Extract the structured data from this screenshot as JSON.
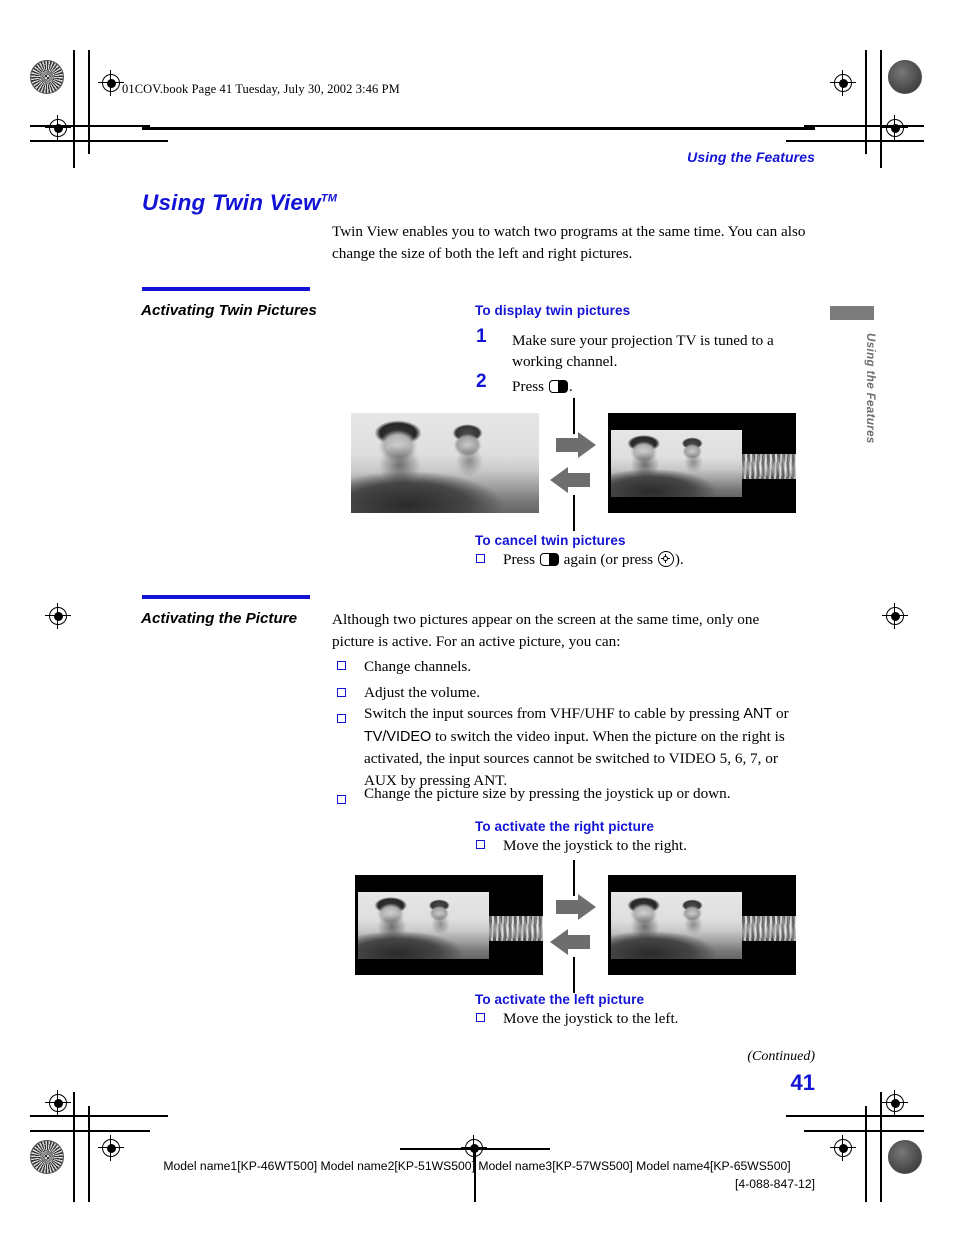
{
  "header": {
    "filestamp": "01COV.book  Page 41  Tuesday, July 30, 2002  3:46 PM",
    "running_head": "Using the Features"
  },
  "side_tab": {
    "label": "Using the Features"
  },
  "title": {
    "main": "Using Twin View",
    "trademark": "TM"
  },
  "intro": "Twin View enables you to watch two programs at the same time. You can also change the size of both the left and right pictures.",
  "sections": [
    {
      "heading": "Activating Twin Pictures",
      "subheads": {
        "display": "To display twin pictures",
        "cancel": "To cancel twin pictures"
      },
      "steps": [
        {
          "num": "1",
          "text": "Make sure your projection TV is tuned to a working channel."
        },
        {
          "num": "2",
          "text_before": "Press",
          "icon": "twin-view-button-icon",
          "text_after": "."
        }
      ],
      "cancel_item": {
        "text_before": "Press",
        "icon1": "twin-view-button-icon",
        "text_middle": "again (or press",
        "icon2": "joystick-icon",
        "text_after": ")."
      }
    },
    {
      "heading": "Activating the Picture",
      "intro": "Although two pictures appear on the screen at the same time, only one picture is active. For an active picture, you can:",
      "bullets": [
        {
          "text": "Change channels."
        },
        {
          "text": "Adjust the volume."
        },
        {
          "line1_a": "Switch the input sources from VHF/UHF to cable by pressing ",
          "kw1": "ANT",
          "line1_b": " or",
          "line2_kw": "TV/VIDEO",
          "line2_b": " to switch the video input.",
          "line3": "When the picture on the right is activated, the input sources cannot be",
          "line4": "switched to VIDEO 5, 6, 7, or AUX  by pressing ANT."
        },
        {
          "text": "Change the picture size by pressing the joystick up or down."
        }
      ],
      "subheads": {
        "right": "To activate the right picture",
        "left": "To activate the left picture"
      },
      "right_item": "Move the joystick to the right.",
      "left_item": "Move the joystick to the left."
    }
  ],
  "diagrams": {
    "twin_display": {
      "name": "twin-view-activation-diagram",
      "left_label": "full-screen-picture",
      "right_label": "twin-picture-left-large",
      "arrow_forward": "arrow-right",
      "arrow_back": "arrow-left"
    },
    "activate_side": {
      "name": "activate-picture-diagram",
      "left_label": "twin-picture-left-active",
      "right_label": "twin-picture-right-active",
      "arrow_forward": "arrow-right",
      "arrow_back": "arrow-left"
    }
  },
  "footer": {
    "continued": "(Continued)",
    "page_number": "41",
    "models": "Model name1[KP-46WT500] Model name2[KP-51WS500] Model name3[KP-57WS500] Model name4[KP-65WS500]",
    "doc_code": "[4-088-847-12]"
  },
  "colors": {
    "accent_blue": "#1313d6",
    "gray_arrow": "#6e6e6e",
    "tab_gray": "#7c7c7c"
  }
}
